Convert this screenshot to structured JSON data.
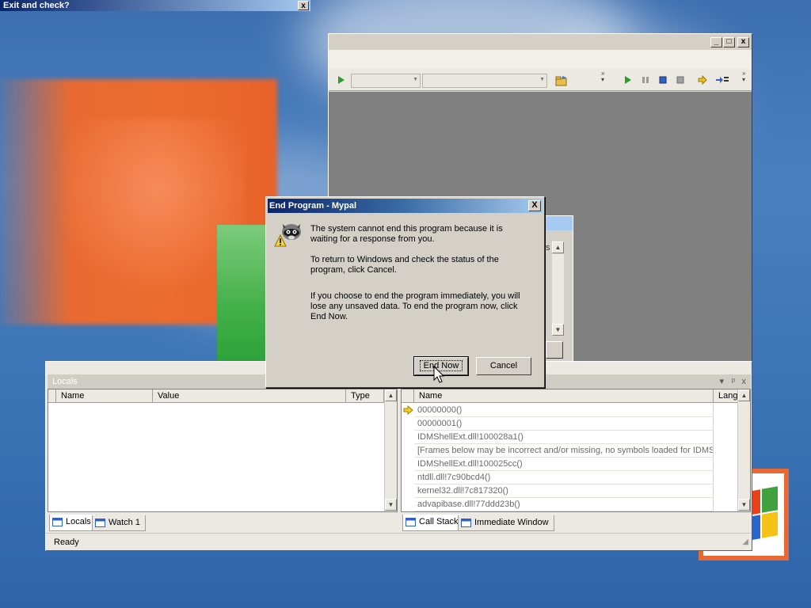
{
  "ghost_window": {
    "title": "Exit and check?",
    "close": "x"
  },
  "ide": {
    "caption_buttons": {
      "minimize": "_",
      "maximize": "□",
      "close": "x"
    },
    "toolbar": {
      "combo1": "",
      "combo2": ""
    }
  },
  "debug_panel": {
    "locals": {
      "title": "Locals",
      "columns": [
        "Name",
        "Value",
        "Type"
      ],
      "tabs": [
        "Locals",
        "Watch 1"
      ]
    },
    "call_stack": {
      "columns": [
        "Name",
        "Lang"
      ],
      "rows": [
        {
          "name": "00000000()",
          "current": true
        },
        {
          "name": "00000001()",
          "current": false
        },
        {
          "name": "IDMShellExt.dll!100028a1()",
          "current": false
        },
        {
          "name": "[Frames below may be incorrect and/or missing, no symbols loaded for IDMShellExt.dll]",
          "current": false
        },
        {
          "name": "IDMShellExt.dll!100025cc()",
          "current": false
        },
        {
          "name": "ntdll.dll!7c90bcd4()",
          "current": false
        },
        {
          "name": "kernel32.dll!7c817320()",
          "current": false
        },
        {
          "name": "advapibase.dll!77ddd23b()",
          "current": false
        }
      ],
      "tabs": [
        "Call Stack",
        "Immediate Window"
      ],
      "pane_buttons": [
        "▾",
        "ᵖ",
        "x"
      ]
    },
    "status": "Ready"
  },
  "hidden_panel": {
    "fragment": "s"
  },
  "dialog": {
    "title": "End Program - Mypal",
    "close": "X",
    "message1": "The system cannot end this program because it is waiting for a response from you.",
    "message2": "To return to Windows and check the status of the program, click Cancel.",
    "message3": "If you choose to end the program immediately, you will lose any unsaved data. To end the program now, click End Now.",
    "end_now": "End Now",
    "cancel": "Cancel"
  }
}
